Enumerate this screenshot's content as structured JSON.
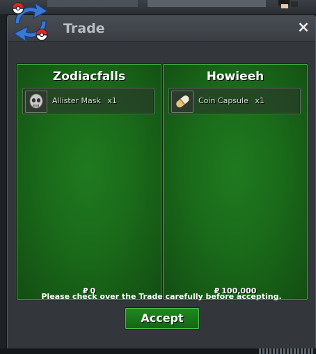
{
  "window": {
    "title": "Trade",
    "close_label": "×"
  },
  "panels": [
    {
      "player": "Zodiacfalls",
      "item": {
        "name": "Allister Mask",
        "qty": "x1",
        "icon": "skull-mask-icon"
      },
      "money_symbol": "₽",
      "money": "0"
    },
    {
      "player": "Howieeh",
      "item": {
        "name": "Coin Capsule",
        "qty": "x1",
        "icon": "capsule-icon"
      },
      "money_symbol": "₽",
      "money": "100,000"
    }
  ],
  "notice": "Please check over the Trade carefully before accepting.",
  "accept_label": "Accept",
  "colors": {
    "panel_green": "#1f7a1f",
    "button_green": "#1f8a1f",
    "window_bg": "#33373c"
  }
}
